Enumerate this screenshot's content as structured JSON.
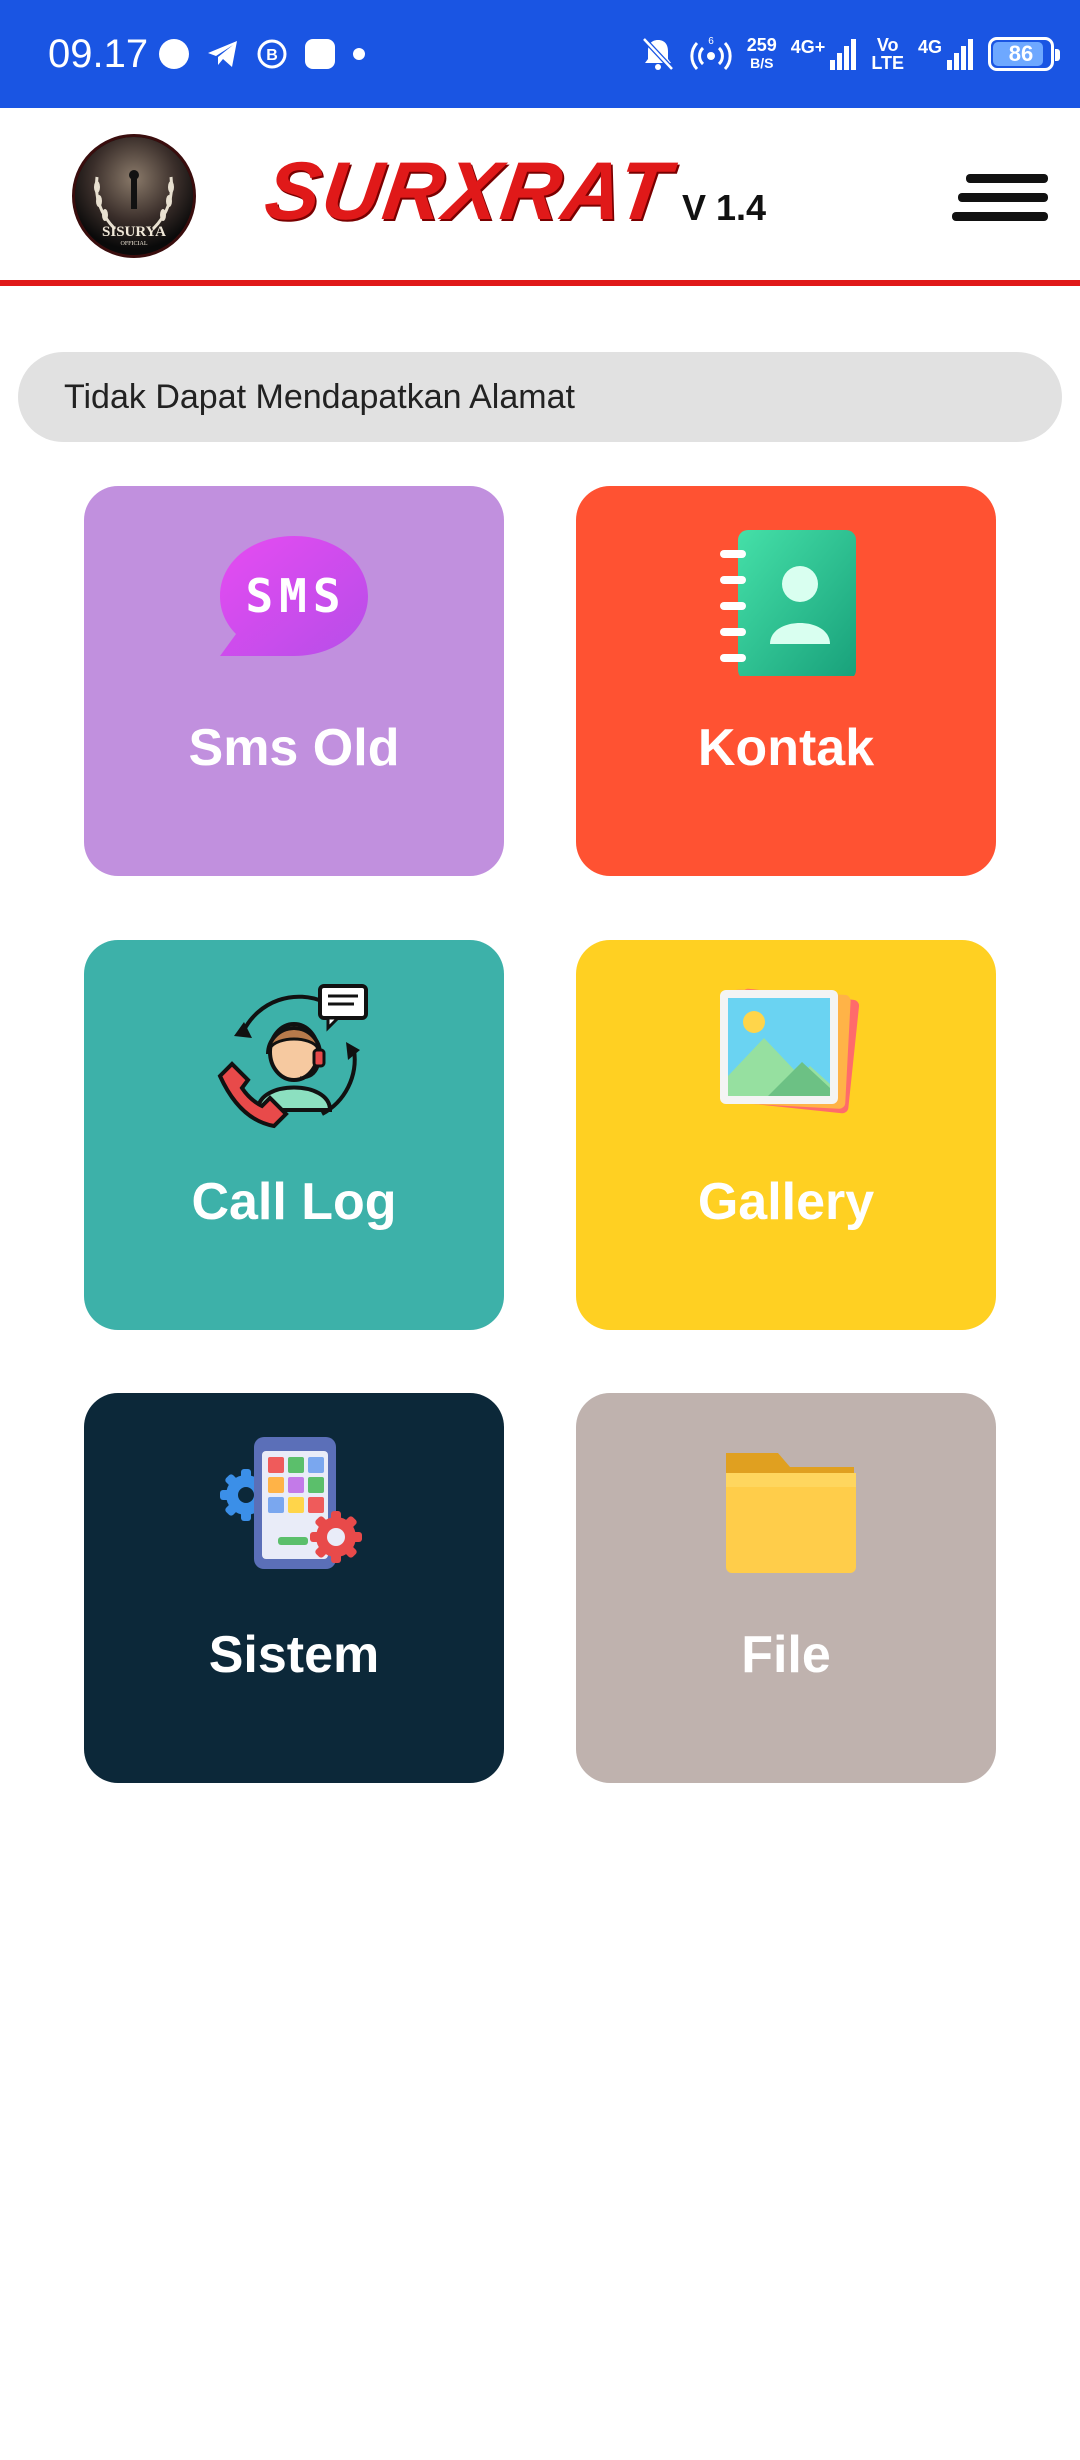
{
  "status_bar": {
    "time": "09.17",
    "net_speed_value": "259",
    "net_speed_unit": "B/S",
    "sim1_label": "4G+",
    "volte_label_top": "Vo",
    "volte_label_bottom": "LTE",
    "sim2_label": "4G",
    "battery_level": "86",
    "icons": [
      "circle-notification-icon",
      "telegram-icon",
      "b-circle-icon",
      "square-notification-icon",
      "dot-icon",
      "mute-bell-icon",
      "hotspot-icon",
      "signal-icon",
      "battery-icon"
    ],
    "background": "#1a55e3"
  },
  "header": {
    "logo_text": "SISURYA",
    "logo_subtext": "OFFICIAL",
    "title": "SURXRAT",
    "version": "V 1.4",
    "menu_icon": "hamburger-menu-icon",
    "accent_color": "#e01919"
  },
  "address": {
    "text": "Tidak Dapat Mendapatkan Alamat"
  },
  "tiles": [
    {
      "label": "Sms Old",
      "icon": "sms-bubble-icon",
      "color": "#c190de",
      "icon_text": "SMS"
    },
    {
      "label": "Kontak",
      "icon": "contact-book-icon",
      "color": "#ff5232"
    },
    {
      "label": "Call Log",
      "icon": "call-support-icon",
      "color": "#3db1a9"
    },
    {
      "label": "Gallery",
      "icon": "gallery-photos-icon",
      "color": "#ffd022"
    },
    {
      "label": "Sistem",
      "icon": "system-settings-phone-icon",
      "color": "#0c2839"
    },
    {
      "label": "File",
      "icon": "folder-icon",
      "color": "#bfb2ae"
    }
  ]
}
